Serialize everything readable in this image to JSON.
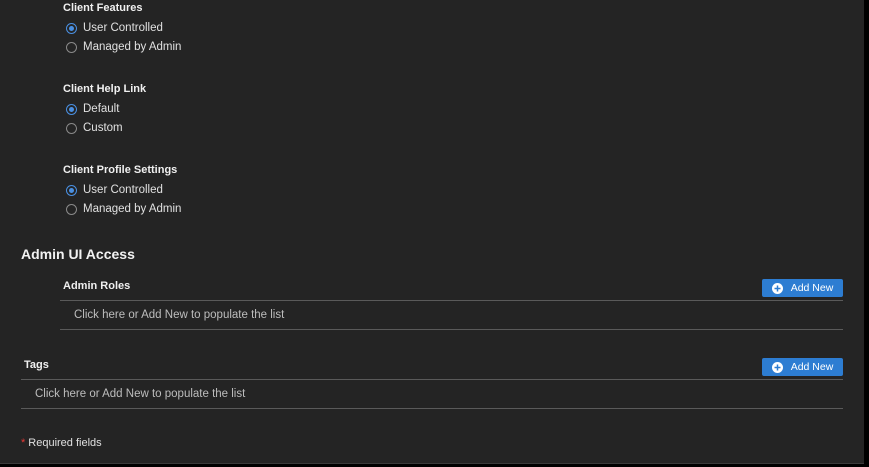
{
  "client_features": {
    "title": "Client Features",
    "options": [
      "User Controlled",
      "Managed by Admin"
    ],
    "selected": 0
  },
  "client_help_link": {
    "title": "Client Help Link",
    "options": [
      "Default",
      "Custom"
    ],
    "selected": 0
  },
  "client_profile_settings": {
    "title": "Client Profile Settings",
    "options": [
      "User Controlled",
      "Managed by Admin"
    ],
    "selected": 0
  },
  "admin_ui_access": {
    "title": "Admin UI Access",
    "admin_roles": {
      "label": "Admin Roles",
      "button": "Add New",
      "empty": "Click here or Add New to populate the list"
    }
  },
  "tags": {
    "label": "Tags",
    "button": "Add New",
    "empty": "Click here or Add New to populate the list"
  },
  "footer": {
    "star": "*",
    "required_text": "Required fields"
  },
  "colors": {
    "accent": "#2d7dd2",
    "required": "#e53935",
    "background": "#242424"
  }
}
